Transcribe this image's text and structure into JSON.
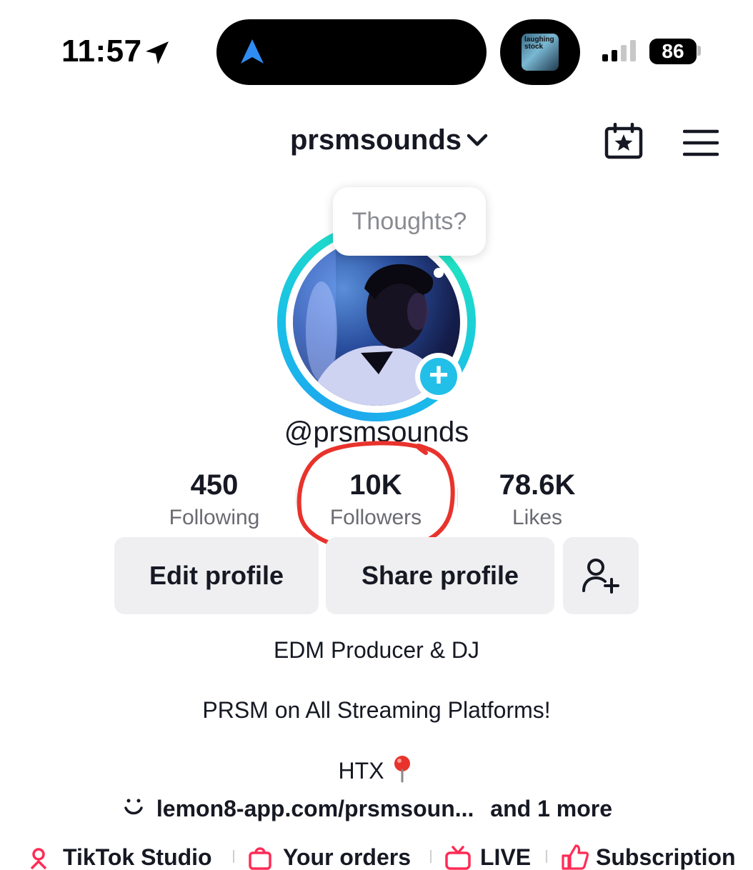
{
  "status_bar": {
    "time": "11:57",
    "battery": "86",
    "album_art_text": "laughing stock"
  },
  "header": {
    "username": "prsmsounds"
  },
  "profile": {
    "thought_bubble": "Thoughts?",
    "handle": "@prsmsounds"
  },
  "stats": [
    {
      "value": "450",
      "label": "Following"
    },
    {
      "value": "10K",
      "label": "Followers"
    },
    {
      "value": "78.6K",
      "label": "Likes"
    }
  ],
  "buttons": {
    "edit": "Edit profile",
    "share": "Share profile"
  },
  "bio": {
    "line1": "EDM Producer & DJ",
    "line2": "PRSM on All Streaming Platforms!",
    "line3": "HTX",
    "link": "lemon8-app.com/prsmsoun...",
    "more": "and 1 more"
  },
  "tools": [
    {
      "label": "TikTok Studio",
      "icon": "studio-icon"
    },
    {
      "label": "Your orders",
      "icon": "bag-icon"
    },
    {
      "label": "LIVE",
      "icon": "tv-icon"
    },
    {
      "label": "Subscription",
      "icon": "thumbs-up-icon"
    }
  ],
  "colors": {
    "accent_cyan": "#22c0e8",
    "annotation_red": "#e8332c",
    "text": "#161823",
    "muted": "#6a6b72"
  }
}
